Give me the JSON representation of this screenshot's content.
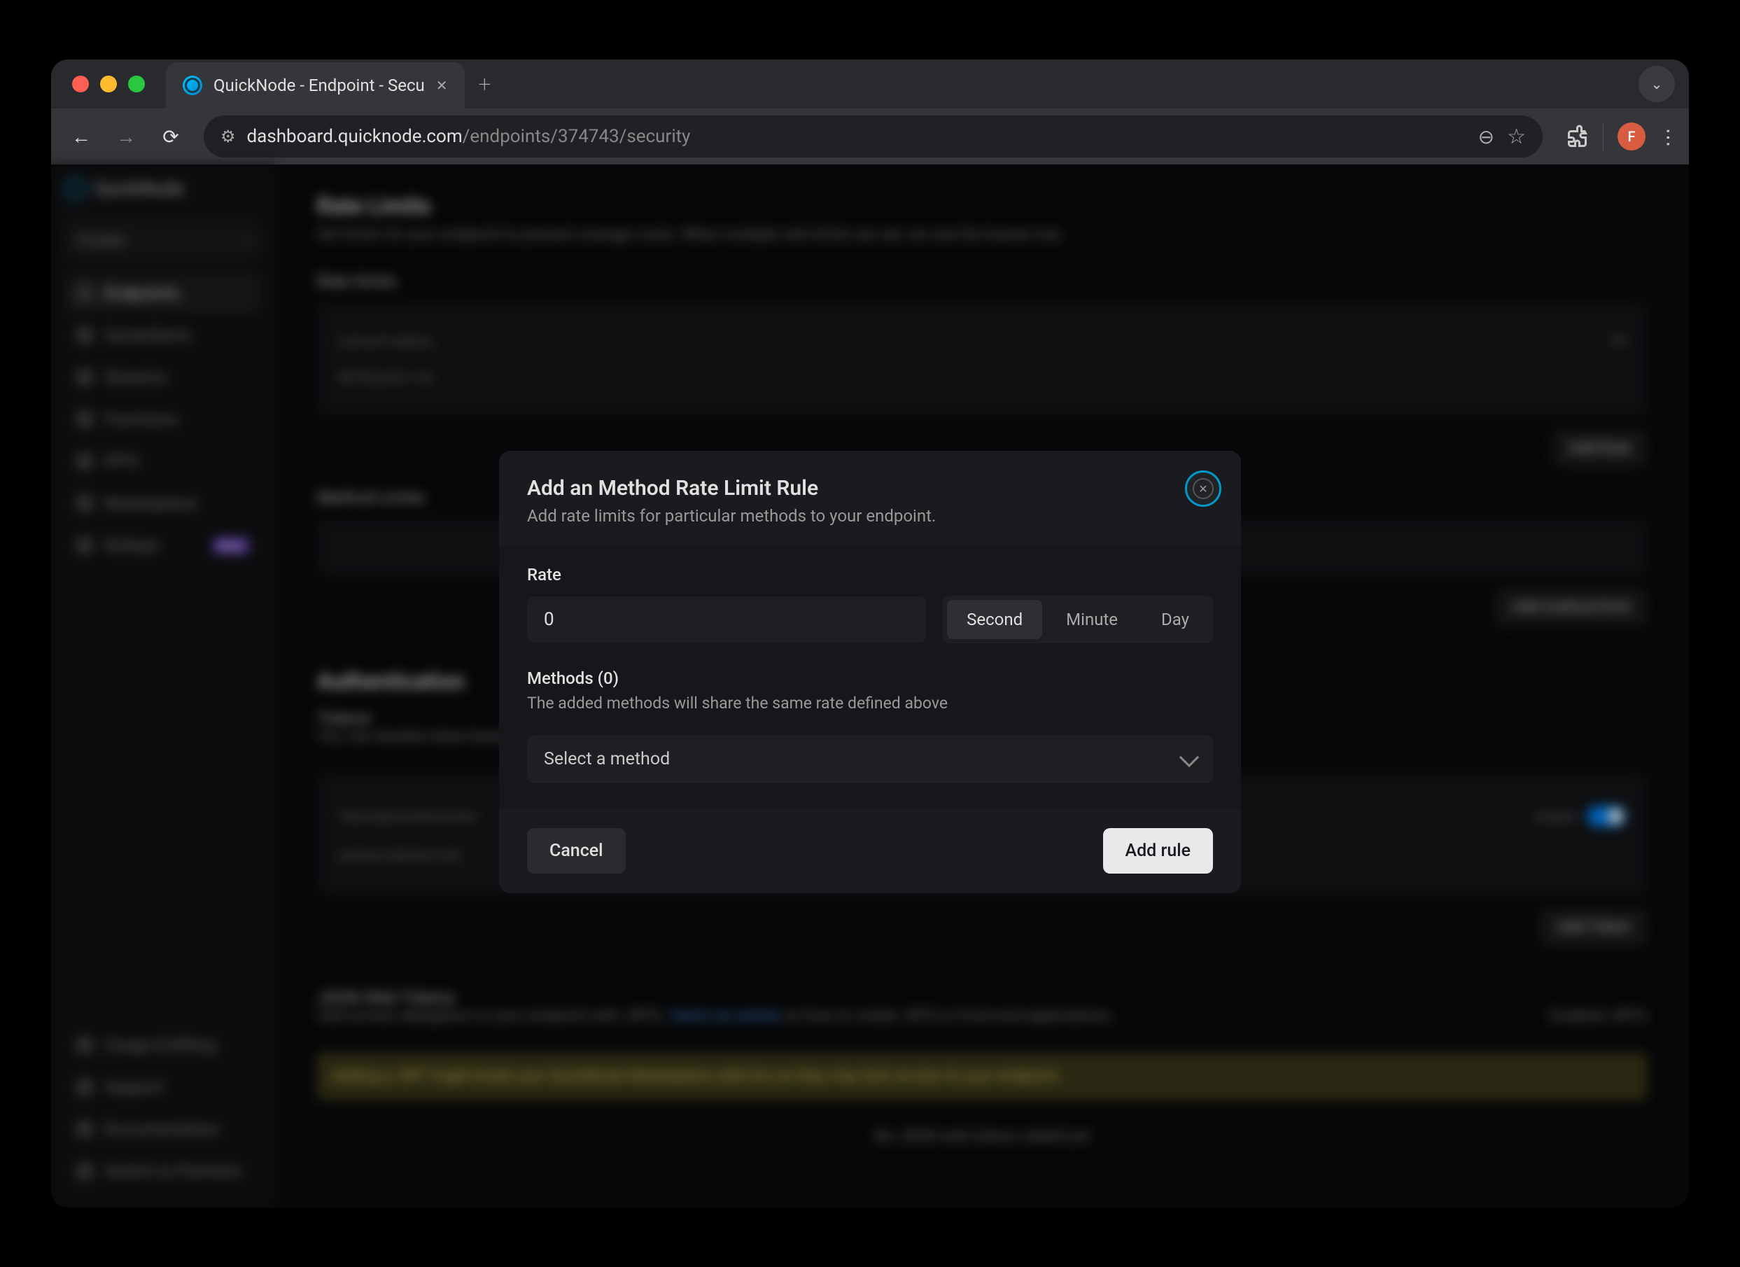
{
  "browser": {
    "tab_title": "QuickNode - Endpoint - Secu",
    "url_display_prefix": "dashboard.quicknode.com",
    "url_display_suffix": "/endpoints/374743/security",
    "avatar_letter": "F"
  },
  "sidebar": {
    "brand": "QuickNode",
    "create": "Create",
    "items": [
      {
        "label": "Endpoints",
        "active": true
      },
      {
        "label": "QuickAlerts"
      },
      {
        "label": "Streams"
      },
      {
        "label": "Functions"
      },
      {
        "label": "IPFS"
      },
      {
        "label": "Marketplace"
      },
      {
        "label": "Rollups",
        "badge": "Beta"
      }
    ],
    "bottom": [
      {
        "label": "Usage & Billing"
      },
      {
        "label": "Support"
      },
      {
        "label": "Documentation"
      },
      {
        "label": "Switch to Partners"
      }
    ]
  },
  "page": {
    "rate_limits_title": "Rate Limits",
    "rate_limits_desc": "Set limits for your endpoint to prevent overage costs. When multiple rate limits are set, we use the lowest one.",
    "rate_limits_section": "Rate limits",
    "limit_by_ip": "Limit by IP address",
    "off": "Off",
    "total_rps": "500 Requests / sec",
    "method_limits": "Method Limits",
    "add_rule": "Add Rule",
    "add_method_limit": "Add method limit",
    "auth_title": "Authentication",
    "tokens": "Tokens",
    "tokens_desc": "You can disable token-based authentication if you'd prefer to only use JWTs or restricting your referrer whitelist below.",
    "token_based_auth": "Token-Based Authentication",
    "enabled": "Enabled",
    "token_value": "ee8344e1548436e716f3...",
    "add_token": "Add Token",
    "jwt_title": "JSON Web Tokens",
    "jwt_desc": "Add access delegation to your endpoint with JWTs.",
    "jwt_link": "Here's an article",
    "jwt_desc_2": " on how to create JWTs in front-end applications.",
    "enabled_jwts": "Enabled JWTs",
    "jwt_warning": "Adding a JWT might break your QuickNode Marketplace add-ons as they may lack access to your endpoint.",
    "no_jwts": "No JSON web tokens added yet"
  },
  "modal": {
    "title": "Add an Method Rate Limit Rule",
    "subtitle": "Add rate limits for particular methods to your endpoint.",
    "rate_label": "Rate",
    "rate_value": "0",
    "time_units": {
      "second": "Second",
      "minute": "Minute",
      "day": "Day"
    },
    "methods_label": "Methods (0)",
    "methods_desc": "The added methods will share the same rate defined above",
    "select_placeholder": "Select a method",
    "cancel": "Cancel",
    "add_rule": "Add rule"
  }
}
